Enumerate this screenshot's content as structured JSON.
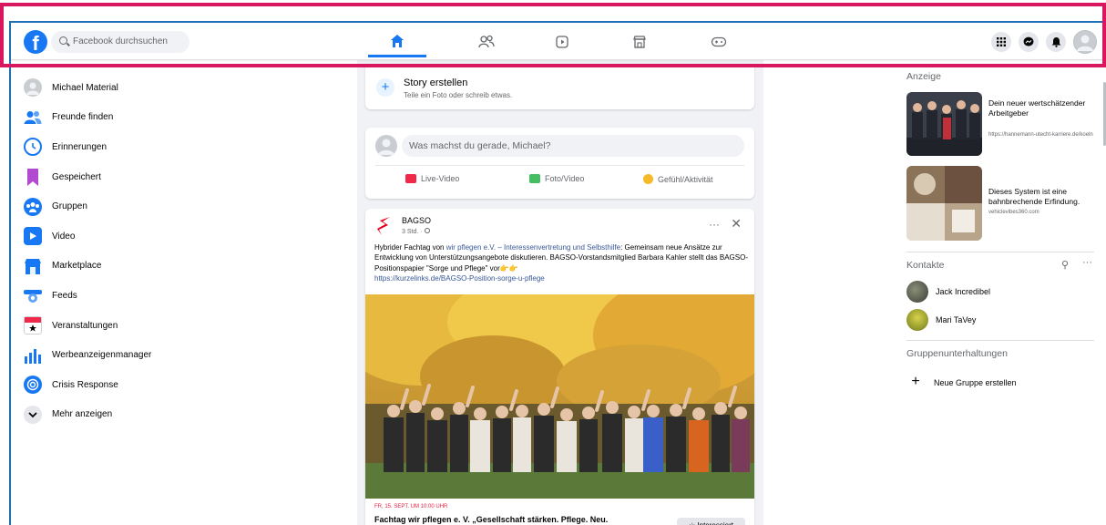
{
  "topbar": {
    "logo_letter": "f",
    "search_placeholder": "Facebook durchsuchen",
    "nav_tabs": [
      {
        "name": "home",
        "icon": "home-icon",
        "active": true
      },
      {
        "name": "friends",
        "icon": "friends-icon",
        "active": false
      },
      {
        "name": "watch",
        "icon": "video-icon",
        "active": false
      },
      {
        "name": "marketplace",
        "icon": "marketplace-icon",
        "active": false
      },
      {
        "name": "gaming",
        "icon": "gaming-icon",
        "active": false
      }
    ],
    "right_icons": [
      "menu-grid-icon",
      "messenger-icon",
      "notifications-icon",
      "account-avatar"
    ]
  },
  "sidebar": {
    "items": [
      {
        "label": "Michael Material",
        "icon": "user-avatar"
      },
      {
        "label": "Freunde finden",
        "icon": "friends-icon"
      },
      {
        "label": "Erinnerungen",
        "icon": "memories-clock-icon"
      },
      {
        "label": "Gespeichert",
        "icon": "bookmark-icon"
      },
      {
        "label": "Gruppen",
        "icon": "groups-icon"
      },
      {
        "label": "Video",
        "icon": "video-icon"
      },
      {
        "label": "Marketplace",
        "icon": "marketplace-icon"
      },
      {
        "label": "Feeds",
        "icon": "feeds-icon"
      },
      {
        "label": "Veranstaltungen",
        "icon": "events-calendar-icon"
      },
      {
        "label": "Werbeanzeigenmanager",
        "icon": "ads-manager-chart-icon"
      },
      {
        "label": "Crisis Response",
        "icon": "crisis-response-icon"
      },
      {
        "label": "Mehr anzeigen",
        "icon": "chevron-down-icon"
      }
    ]
  },
  "story": {
    "title": "Story erstellen",
    "subtitle": "Teile ein Foto oder schreib etwas."
  },
  "composer": {
    "placeholder": "Was machst du gerade, Michael?",
    "actions": [
      {
        "label": "Live-Video",
        "color": "#f02849"
      },
      {
        "label": "Foto/Video",
        "color": "#45bd62"
      },
      {
        "label": "Gefühl/Aktivität",
        "color": "#f7b928"
      }
    ]
  },
  "post": {
    "author": "BAGSO",
    "time": "3 Std. ·",
    "text_before": "Hybrider Fachtag von ",
    "link1": "wir pflegen e.V. – Interessenvertretung und Selbsthilfe",
    "text_after": ": Gemeinsam neue Ansätze zur Entwicklung von Unterstützungsangebote diskutieren. BAGSO-Vorstandsmitglied Barbara Kahler stellt das BAGSO-Positionspapier \"Sorge und Pflege\" vor👉👉",
    "link2": "https://kurzelinks.de/BAGSO-Position-sorge-u-pflege",
    "event_date": "FR, 15. SEPT. UM 10:00 UHR",
    "event_title": "Fachtag wir pflegen e. V. „Gesellschaft stärken. Pflege. Neu.",
    "interest_label": "☆ Interessiert"
  },
  "right": {
    "ads_header": "Anzeige",
    "ads": [
      {
        "title": "Dein neuer wertschätzender Arbeitgeber",
        "url": "https://hannemann-utecht-karriere.de/koeln"
      },
      {
        "title": "Dieses System ist eine bahnbrechende Erfindung.",
        "url": "vehiclevibes360.com"
      }
    ],
    "contacts_header": "Kontakte",
    "contacts": [
      {
        "name": "Jack Incredibel"
      },
      {
        "name": "Mari TaVey"
      }
    ],
    "groups_header": "Gruppenunterhaltungen",
    "new_group": "Neue Gruppe erstellen"
  },
  "colors": {
    "brand": "#1877f2",
    "annotation_red": "#d8175e",
    "annotation_blue": "#1f6fb6"
  }
}
